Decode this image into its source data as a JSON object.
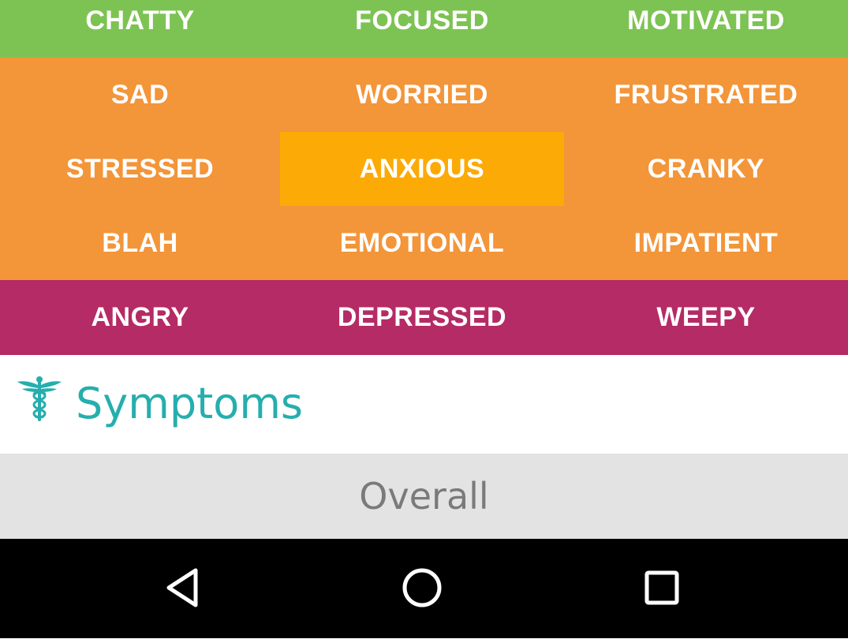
{
  "colors": {
    "positive": "#7dc353",
    "neutral": "#f39539",
    "selected": "#fcaa06",
    "negative": "#b52b65",
    "accent": "#26aeae",
    "tab_bg": "#e3e3e3",
    "nav_bg": "#000000"
  },
  "moods": {
    "row_positive": [
      "CHATTY",
      "FOCUSED",
      "MOTIVATED"
    ],
    "row_neutral_1": [
      "SAD",
      "WORRIED",
      "FRUSTRATED"
    ],
    "row_neutral_2": [
      "STRESSED",
      "ANXIOUS",
      "CRANKY"
    ],
    "row_neutral_3": [
      "BLAH",
      "EMOTIONAL",
      "IMPATIENT"
    ],
    "row_negative": [
      "ANGRY",
      "DEPRESSED",
      "WEEPY"
    ],
    "selected": "ANXIOUS"
  },
  "symptoms": {
    "icon": "caduceus-icon",
    "title": "Symptoms"
  },
  "tabs": {
    "overall": "Overall"
  },
  "nav": {
    "back_icon": "back-triangle-icon",
    "home_icon": "home-circle-icon",
    "recents_icon": "recents-square-icon"
  }
}
